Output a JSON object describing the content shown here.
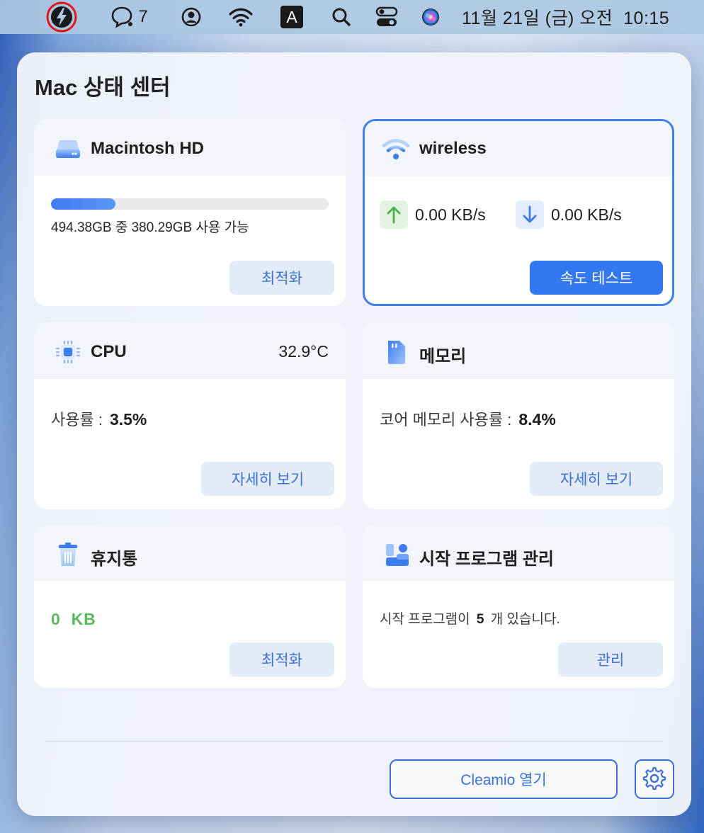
{
  "menubar": {
    "app_icon": "cleamio-lightning-icon",
    "chat_count": "7",
    "clock": "11월 21일 (금) 오전  10:15",
    "keyboard_input": "A",
    "icons": [
      "cleamio-lightning-icon",
      "chat-bubbles-icon",
      "user-account-icon",
      "wifi-icon",
      "input-source-icon",
      "search-icon",
      "control-center-icon",
      "siri-icon"
    ]
  },
  "panel": {
    "title": "Mac 상태 센터",
    "disk": {
      "title": "Macintosh HD",
      "icon": "hard-drive-icon",
      "used_fraction": 0.231,
      "info": "494.38GB 중 380.29GB 사용 가능",
      "button": "최적화"
    },
    "network": {
      "title": "wireless",
      "icon": "wifi-icon",
      "upload": "0.00 KB/s",
      "download": "0.00 KB/s",
      "button": "속도 테스트"
    },
    "cpu": {
      "title": "CPU",
      "icon": "cpu-chip-icon",
      "temperature": "32.9°C",
      "usage_label": "사용률 :",
      "usage_value": "3.5%",
      "button": "자세히 보기"
    },
    "memory": {
      "title": "메모리",
      "icon": "memory-card-icon",
      "usage_label": "코어 메모리 사용률 :",
      "usage_value": "8.4%",
      "button": "자세히 보기"
    },
    "trash": {
      "title": "휴지통",
      "icon": "trash-icon",
      "size": "0  KB",
      "button": "최적화"
    },
    "startup": {
      "title": "시작 프로그램 관리",
      "icon": "startup-apps-icon",
      "text_before": "시작 프로그램이",
      "count": "5",
      "text_after": "개 있습니다.",
      "button": "관리"
    },
    "open_button": "Cleamio 열기",
    "settings_icon": "gear-icon"
  },
  "colors": {
    "accent": "#3478f0",
    "accent_text": "#3c72d4",
    "trash_size_green": "#5cb85c",
    "upload_green": "#4cae4c",
    "download_blue": "#3c7ce8"
  }
}
